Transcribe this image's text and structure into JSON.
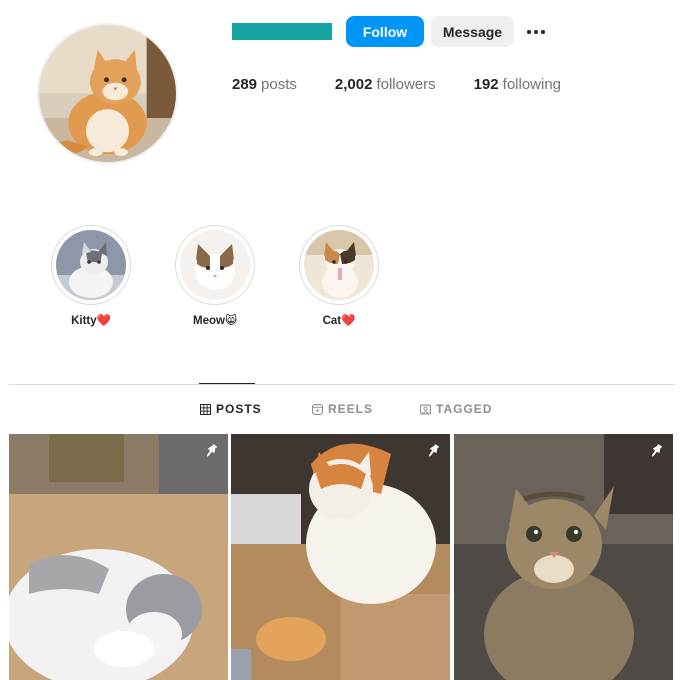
{
  "profile": {
    "accent_color": "#14a3a0",
    "follow_label": "Follow",
    "message_label": "Message",
    "more_icon": "more-horizontal-icon"
  },
  "stats": {
    "posts_count": "289",
    "posts_label": "posts",
    "followers_count": "2,002",
    "followers_label": "followers",
    "following_count": "192",
    "following_label": "following"
  },
  "highlights": [
    {
      "label": "Kitty❤️"
    },
    {
      "label": "Meow😸"
    },
    {
      "label": "Cat❤️"
    }
  ],
  "tabs": [
    {
      "label": "POSTS",
      "icon": "grid-icon",
      "active": true
    },
    {
      "label": "REELS",
      "icon": "reels-icon",
      "active": false
    },
    {
      "label": "TAGGED",
      "icon": "tagged-icon",
      "active": false
    }
  ],
  "posts": [
    {
      "subject": "grey and white cat lying on its back",
      "pinned": true
    },
    {
      "subject": "orange and white cat with kitten in box",
      "pinned": true
    },
    {
      "subject": "tabby cat looking at camera",
      "pinned": true
    }
  ],
  "colors": {
    "follow_button": "#0095f6",
    "message_button": "#efefef",
    "divider": "#dbdbdb"
  }
}
